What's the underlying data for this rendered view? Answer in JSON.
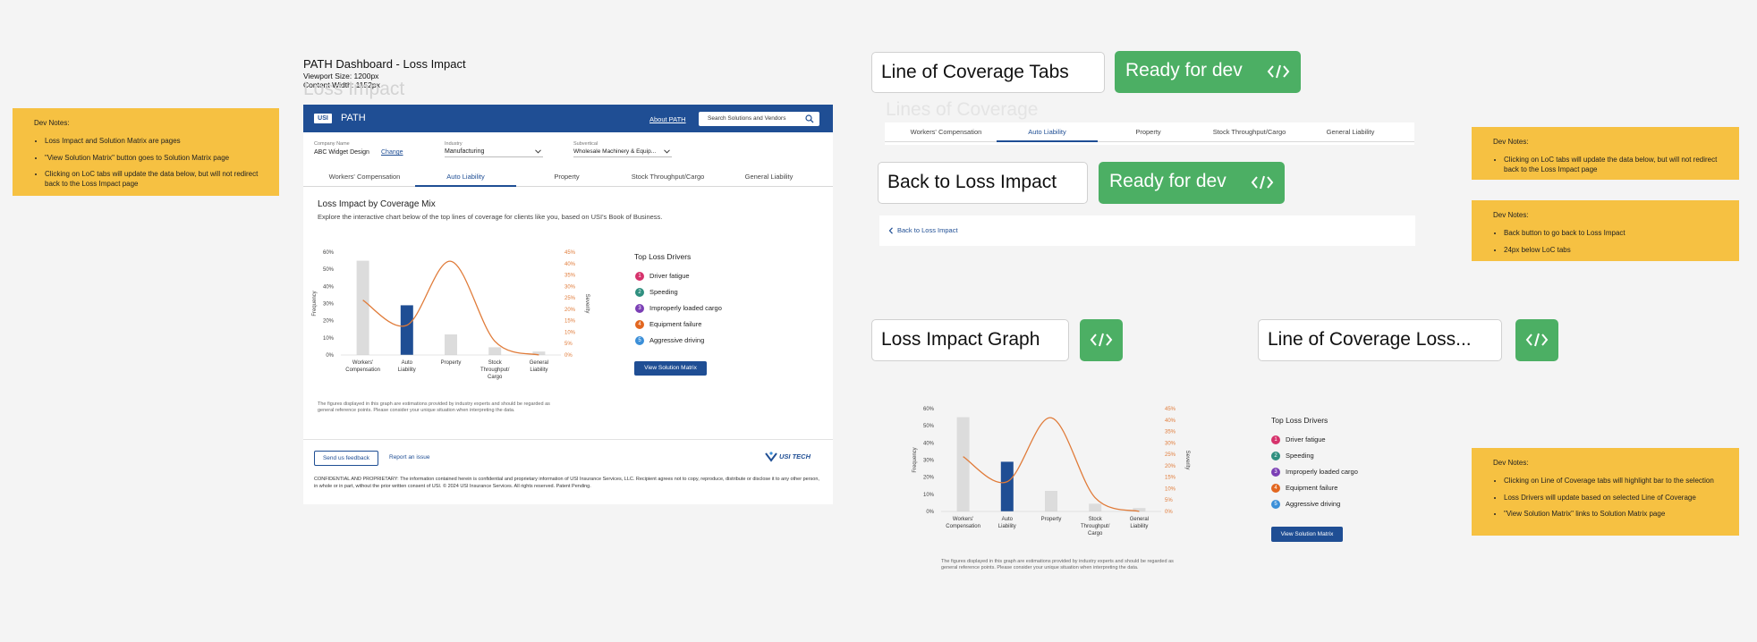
{
  "left_note": {
    "title": "Dev Notes:",
    "items": [
      "Loss Impact and Solution Matrix are pages",
      "\"View Solution Matrix\" button goes to Solution Matrix page",
      "Clicking on LoC tabs will update the data below, but will not redirect back to the Loss Impact page"
    ]
  },
  "frame": {
    "title": "PATH Dashboard - Loss Impact",
    "viewport": "Viewport Size: 1200px",
    "content_width": "Content Width: 1152px",
    "ghost_title": "Loss Impact"
  },
  "header": {
    "logo": "USI",
    "title": "PATH",
    "about": "About PATH",
    "search_placeholder": "Search Solutions and Vendors"
  },
  "selectors": {
    "company_label": "Company Name",
    "company_value": "ABC Widget Design",
    "change": "Change",
    "industry_label": "Industry",
    "industry_value": "Manufacturing",
    "subvertical_label": "Subvertical",
    "subvertical_value": "Wholesale Machinery & Equip..."
  },
  "tabs": [
    "Workers' Compensation",
    "Auto Liability",
    "Property",
    "Stock Throughput/Cargo",
    "General Liability"
  ],
  "active_tab": "Auto Liability",
  "section": {
    "title": "Loss Impact by Coverage Mix",
    "description": "Explore the interactive chart below of the top lines of coverage for clients like you, based on USI's Book of Business."
  },
  "drivers": {
    "title": "Top Loss Drivers",
    "items": [
      {
        "n": "1",
        "label": "Driver fatigue",
        "color": "#d6336c"
      },
      {
        "n": "2",
        "label": "Speeding",
        "color": "#2f8f7f"
      },
      {
        "n": "3",
        "label": "Improperly loaded cargo",
        "color": "#7b3fb5"
      },
      {
        "n": "4",
        "label": "Equipment failure",
        "color": "#e2661f"
      },
      {
        "n": "5",
        "label": "Aggressive driving",
        "color": "#3b8fd8"
      }
    ],
    "button": "View Solution Matrix"
  },
  "disclaimer": "The figures displayed in this graph are estimations provided by industry experts and should be regarded as general reference points. Please consider your unique situation when interpreting the data.",
  "footer": {
    "feedback": "Send us feedback",
    "report": "Report an issue",
    "brand": "USI TECH",
    "legal": "CONFIDENTIAL AND PROPRIETARY: The information contained herein is confidential and proprietary information of USI Insurance Services, LLC. Recipient agrees not to copy, reproduce, distribute or disclose it to any other person, in whole or in part, without the prior written consent of USI.  © 2024 USI Insurance Services. All rights reserved. Patent Pending."
  },
  "labels": {
    "loc_tabs": "Line of Coverage Tabs",
    "ready": "Ready for dev",
    "loc_ghost": "Lines of Coverage",
    "back_to_loss": "Back to Loss Impact",
    "back_link": "Back to Loss Impact",
    "loss_graph": "Loss Impact Graph",
    "loc_loss": "Line of Coverage Loss..."
  },
  "right_notes": [
    {
      "title": "Dev Notes:",
      "items": [
        "Clicking on LoC tabs will update the data below, but will not redirect back to the Loss Impact page"
      ]
    },
    {
      "title": "Dev Notes:",
      "items": [
        "Back button to go back to Loss Impact",
        "24px below LoC tabs"
      ]
    },
    {
      "title": "Dev Notes:",
      "items": [
        "Clicking on Line of Coverage tabs will highlight bar to the selection",
        "Loss Drivers will update based on selected Line of Coverage",
        "\"View Solution Matrix\" links to Solution Matrix page"
      ]
    }
  ],
  "colors": {
    "brand": "#1f4e94",
    "bar_gray": "#dcdcdc",
    "curve": "#e07b39",
    "ready_green": "#4caf64",
    "note_yellow": "#f6c142"
  },
  "chart_data": {
    "type": "bar",
    "categories": [
      "Workers' Compensation",
      "Auto Liability",
      "Property",
      "Stock Throughput/ Cargo",
      "General Liability"
    ],
    "series": [
      {
        "values": [
          55,
          29,
          12,
          4.5,
          2
        ],
        "axis": "left"
      },
      {
        "values": [
          24,
          13,
          41,
          6,
          0
        ],
        "axis": "right",
        "style": "smooth-line"
      }
    ],
    "highlight": "Auto Liability",
    "ylabel": "Frequency",
    "y2label": "Severity",
    "ylim": [
      0,
      60
    ],
    "y2lim": [
      0,
      45
    ],
    "yticks": [
      "0%",
      "10%",
      "20%",
      "30%",
      "40%",
      "50%",
      "60%"
    ],
    "y2ticks": [
      "0%",
      "5%",
      "10%",
      "15%",
      "20%",
      "25%",
      "30%",
      "35%",
      "40%",
      "45%"
    ],
    "grid": false
  }
}
